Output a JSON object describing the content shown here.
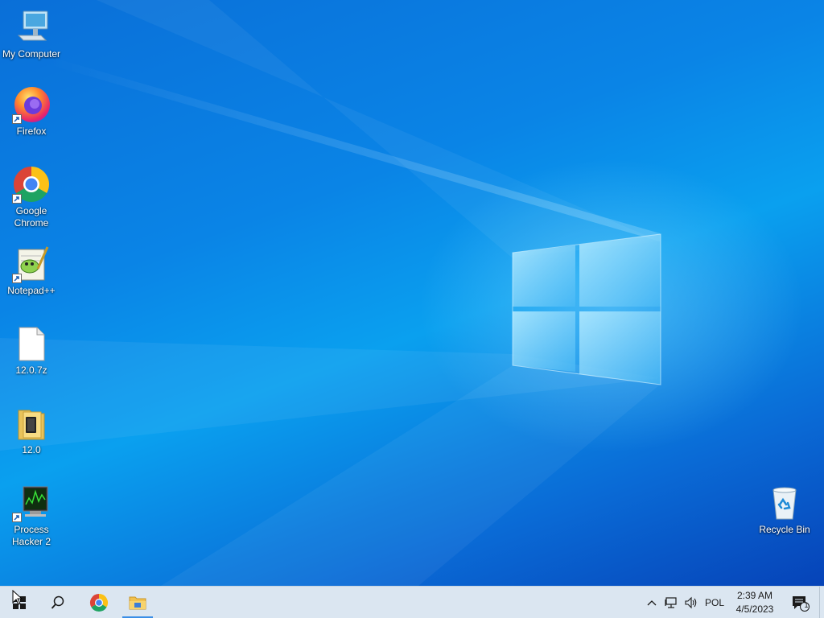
{
  "desktop": {
    "icons": [
      {
        "label": "My Computer",
        "icon": "computer-icon"
      },
      {
        "label": "Firefox",
        "icon": "firefox-icon"
      },
      {
        "label": "Google Chrome",
        "icon": "chrome-icon"
      },
      {
        "label": "Notepad++",
        "icon": "notepadpp-icon"
      },
      {
        "label": "12.0.7z",
        "icon": "file-icon"
      },
      {
        "label": "12.0",
        "icon": "folder-icon"
      },
      {
        "label": "Process Hacker 2",
        "icon": "process-hacker-icon"
      },
      {
        "label": "Recycle Bin",
        "icon": "recycle-bin-icon"
      }
    ]
  },
  "taskbar": {
    "pinned": [
      {
        "name": "Start",
        "icon": "windows-start-icon"
      },
      {
        "name": "Search",
        "icon": "search-icon"
      },
      {
        "name": "Google Chrome",
        "icon": "chrome-icon"
      },
      {
        "name": "File Explorer",
        "icon": "file-explorer-icon",
        "active": true
      }
    ],
    "tray": {
      "language": "POL",
      "time": "2:39 AM",
      "date": "4/5/2023",
      "notification_count": "1"
    }
  },
  "colors": {
    "wallpaper_primary": "#0a84e6",
    "wallpaper_dark": "#0643b8",
    "taskbar_bg": "#dbe6f1",
    "accent": "#3a8ee6"
  }
}
